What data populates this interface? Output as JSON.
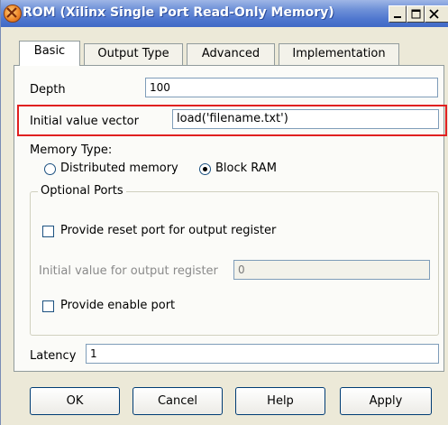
{
  "window": {
    "title": "ROM (Xilinx Single Port Read-Only Memory)",
    "icon": "xilinx-logo-icon",
    "caption_buttons": [
      "minimize-icon",
      "maximize-icon",
      "close-icon"
    ]
  },
  "tabs": [
    {
      "label": "Basic",
      "active": true
    },
    {
      "label": "Output Type",
      "active": false
    },
    {
      "label": "Advanced",
      "active": false
    },
    {
      "label": "Implementation",
      "active": false
    }
  ],
  "form": {
    "depth_label": "Depth",
    "depth_value": "100",
    "init_label": "Initial value vector",
    "init_value": "load('filename.txt')",
    "memory_type_label": "Memory Type:",
    "memory_options": [
      {
        "label": "Distributed memory",
        "selected": false
      },
      {
        "label": "Block RAM",
        "selected": true
      }
    ],
    "optional_ports_label": "Optional Ports",
    "reset_port_label": "Provide reset port for output register",
    "reset_port_checked": false,
    "init_output_label": "Initial value for output register",
    "init_output_value": "0",
    "enable_port_label": "Provide enable port",
    "enable_port_checked": false,
    "latency_label": "Latency",
    "latency_value": "1"
  },
  "buttons": {
    "ok": "OK",
    "cancel": "Cancel",
    "help": "Help",
    "apply": "Apply"
  },
  "colors": {
    "titlebar": "#4f77cf",
    "highlight_box": "#e02020"
  }
}
